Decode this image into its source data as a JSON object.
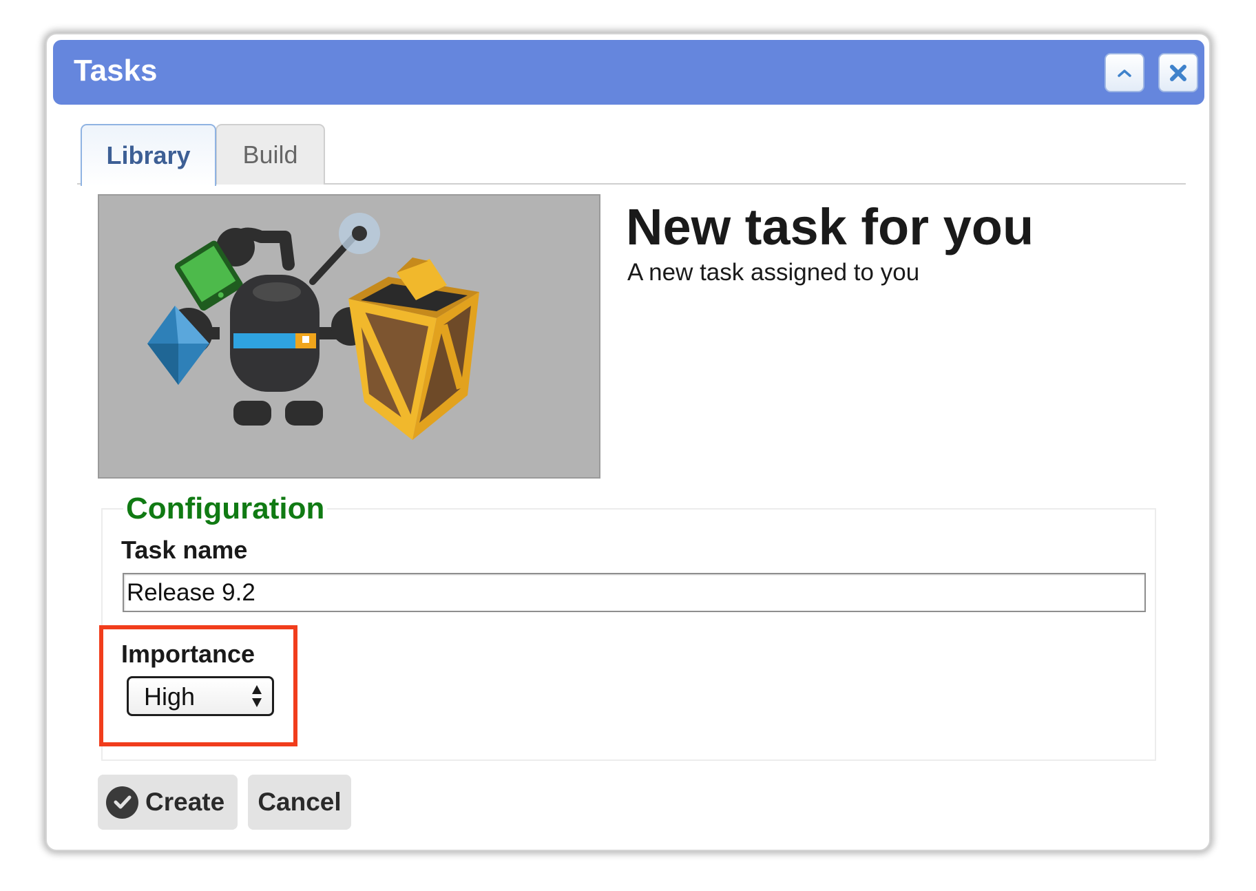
{
  "window": {
    "title": "Tasks",
    "minimize_icon": "chevron-up-icon",
    "close_icon": "close-icon"
  },
  "tabs": [
    {
      "label": "Library",
      "active": true
    },
    {
      "label": "Build",
      "active": false
    }
  ],
  "hero": {
    "headline": "New task for you",
    "subline": "A new task assigned to you",
    "illustration": "robot-with-crate-illustration"
  },
  "configuration": {
    "legend": "Configuration",
    "task_name_label": "Task name",
    "task_name_value": "Release 9.2",
    "importance_label": "Importance",
    "importance_value": "High"
  },
  "actions": {
    "create_label": "Create",
    "cancel_label": "Cancel"
  },
  "colors": {
    "titlebar": "#6586dd",
    "legend": "#107a13",
    "highlight": "#f13d1c"
  }
}
